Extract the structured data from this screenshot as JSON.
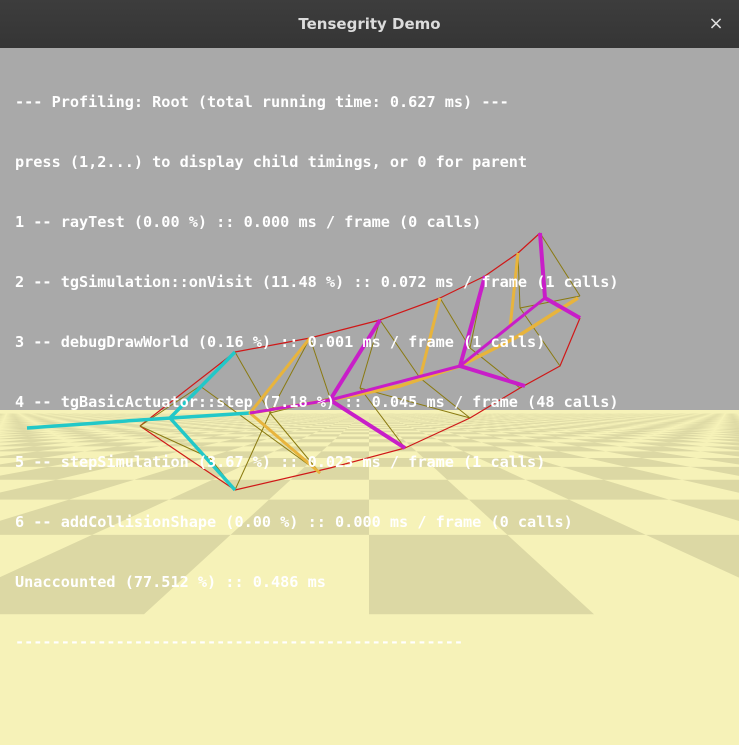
{
  "window": {
    "title": "Tensegrity Demo",
    "close_glyph": "×"
  },
  "profiling": {
    "lines": [
      "--- Profiling: Root (total running time: 0.627 ms) ---",
      "press (1,2...) to display child timings, or 0 for parent",
      "1 -- rayTest (0.00 %) :: 0.000 ms / frame (0 calls)",
      "2 -- tgSimulation::onVisit (11.48 %) :: 0.072 ms / frame (1 calls)",
      "3 -- debugDrawWorld (0.16 %) :: 0.001 ms / frame (1 calls)",
      "4 -- tgBasicActuator::step (7.18 %) :: 0.045 ms / frame (48 calls)",
      "5 -- stepSimulation (3.67 %) :: 0.023 ms / frame (1 calls)",
      "6 -- addCollisionShape (0.00 %) :: 0.000 ms / frame (0 calls)",
      "Unaccounted (77.512 %) :: 0.486 ms",
      "-------------------------------------------------"
    ]
  },
  "scene": {
    "sky_color": "#a9a9a9",
    "floor_light_color": "#f6f2b8",
    "floor_dark_color": "#dcd8a4",
    "rod_colors": {
      "cyan": "#22c8c8",
      "gold": "#e8b43c",
      "magenta": "#c81ec8"
    },
    "cable_colors": {
      "red": "#d01818",
      "olive": "#8a7a10"
    }
  }
}
